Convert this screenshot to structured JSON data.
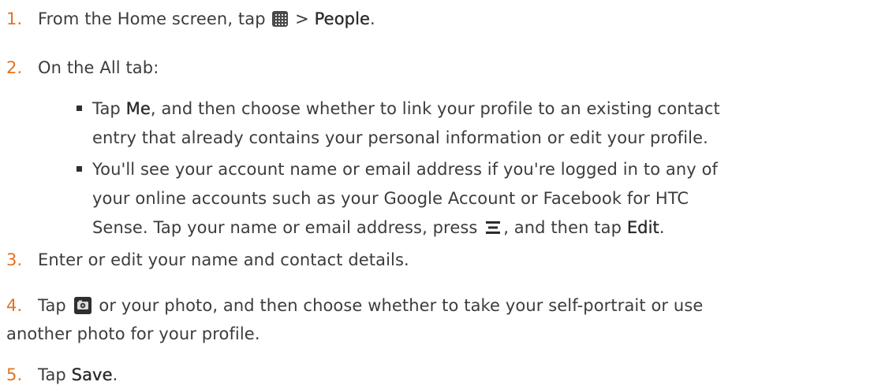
{
  "steps": [
    {
      "num": "1.",
      "parts": [
        "From the Home screen, tap",
        " > ",
        "People",
        "."
      ]
    },
    {
      "num": "2.",
      "text": "On the All tab:"
    },
    {
      "num": "3.",
      "text": "Enter or edit your name and contact details."
    },
    {
      "num": "4.",
      "line1_a": "Tap",
      "line1_b": " or your photo, and then choose whether to take your self-portrait or use",
      "line2": "another photo for your profile."
    },
    {
      "num": "5.",
      "text_a": "Tap ",
      "text_b": "Save",
      "text_c": "."
    }
  ],
  "bullets": [
    {
      "line1_a": "Tap ",
      "line1_b": "Me",
      "line1_c": ", and then choose whether to link your profile to an existing contact",
      "line2": "entry that already contains your personal information or edit your profile."
    },
    {
      "line1": "You'll see your account name or email address if you're logged in to any of",
      "line2": "your online accounts such as your Google Account or Facebook for HTC",
      "line3_a": "Sense. Tap your name or email address, press",
      "line3_b": ", and then tap ",
      "line3_c": "Edit",
      "line3_d": "."
    }
  ],
  "icons": {
    "all_apps": "all-apps-grid-icon",
    "menu": "menu-icon",
    "camera": "camera-icon"
  }
}
